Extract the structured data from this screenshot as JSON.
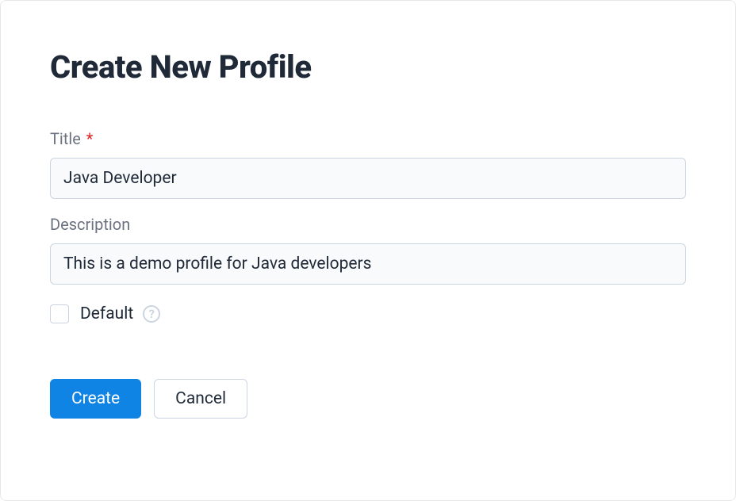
{
  "heading": "Create New Profile",
  "fields": {
    "title": {
      "label": "Title",
      "required_mark": "*",
      "value": "Java Developer"
    },
    "description": {
      "label": "Description",
      "value": "This is a demo profile for Java developers"
    },
    "default": {
      "label": "Default",
      "help_symbol": "?",
      "checked": false
    }
  },
  "buttons": {
    "create": "Create",
    "cancel": "Cancel"
  }
}
